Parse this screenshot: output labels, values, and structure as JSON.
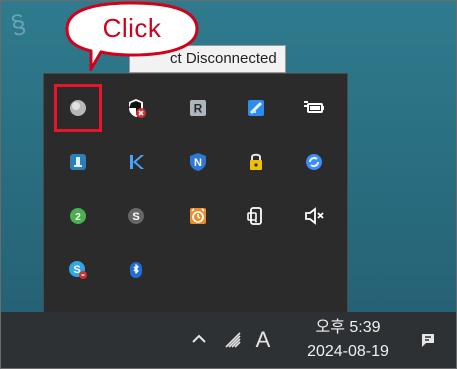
{
  "tooltip": {
    "text": "ct Disconnected"
  },
  "callout": {
    "label": "Click"
  },
  "clock": {
    "time": "오후 5:39",
    "date": "2024-08-19"
  },
  "taskbar": {
    "input_indicator": "A"
  },
  "tray_icons": [
    {
      "name": "globe-icon",
      "color": "#9a9a9a"
    },
    {
      "name": "shield-blocked-icon",
      "color": "#ffffff"
    },
    {
      "name": "r-app-icon",
      "color": "#9aa2a8"
    },
    {
      "name": "paint-tool-icon",
      "color": "#2d8cf0"
    },
    {
      "name": "battery-power-icon",
      "color": "#ffffff"
    },
    {
      "name": "tower-app-icon",
      "color": "#2e7fb8"
    },
    {
      "name": "k-app-icon",
      "color": "#4aa3ff"
    },
    {
      "name": "n-badge-icon",
      "color": "#2f79d6"
    },
    {
      "name": "security-lock-icon",
      "color": "#f0c000"
    },
    {
      "name": "sync-swirl-icon",
      "color": "#3b8cff"
    },
    {
      "name": "green-circle-app-icon",
      "color": "#4caf50"
    },
    {
      "name": "s-app-icon",
      "color": "#6b6b6b"
    },
    {
      "name": "alarm-clock-icon",
      "color": "#f08a24"
    },
    {
      "name": "phone-link-icon",
      "color": "#ffffff"
    },
    {
      "name": "speaker-muted-icon",
      "color": "#ffffff"
    },
    {
      "name": "skype-icon",
      "color": "#2fa7e6"
    },
    {
      "name": "bluetooth-icon",
      "color": "#1f6fd6"
    }
  ],
  "colors": {
    "highlight": "#e7162a",
    "callout_border": "#d0021b",
    "taskbar": "#2d3134",
    "overflow_panel": "#2b2b2b"
  }
}
